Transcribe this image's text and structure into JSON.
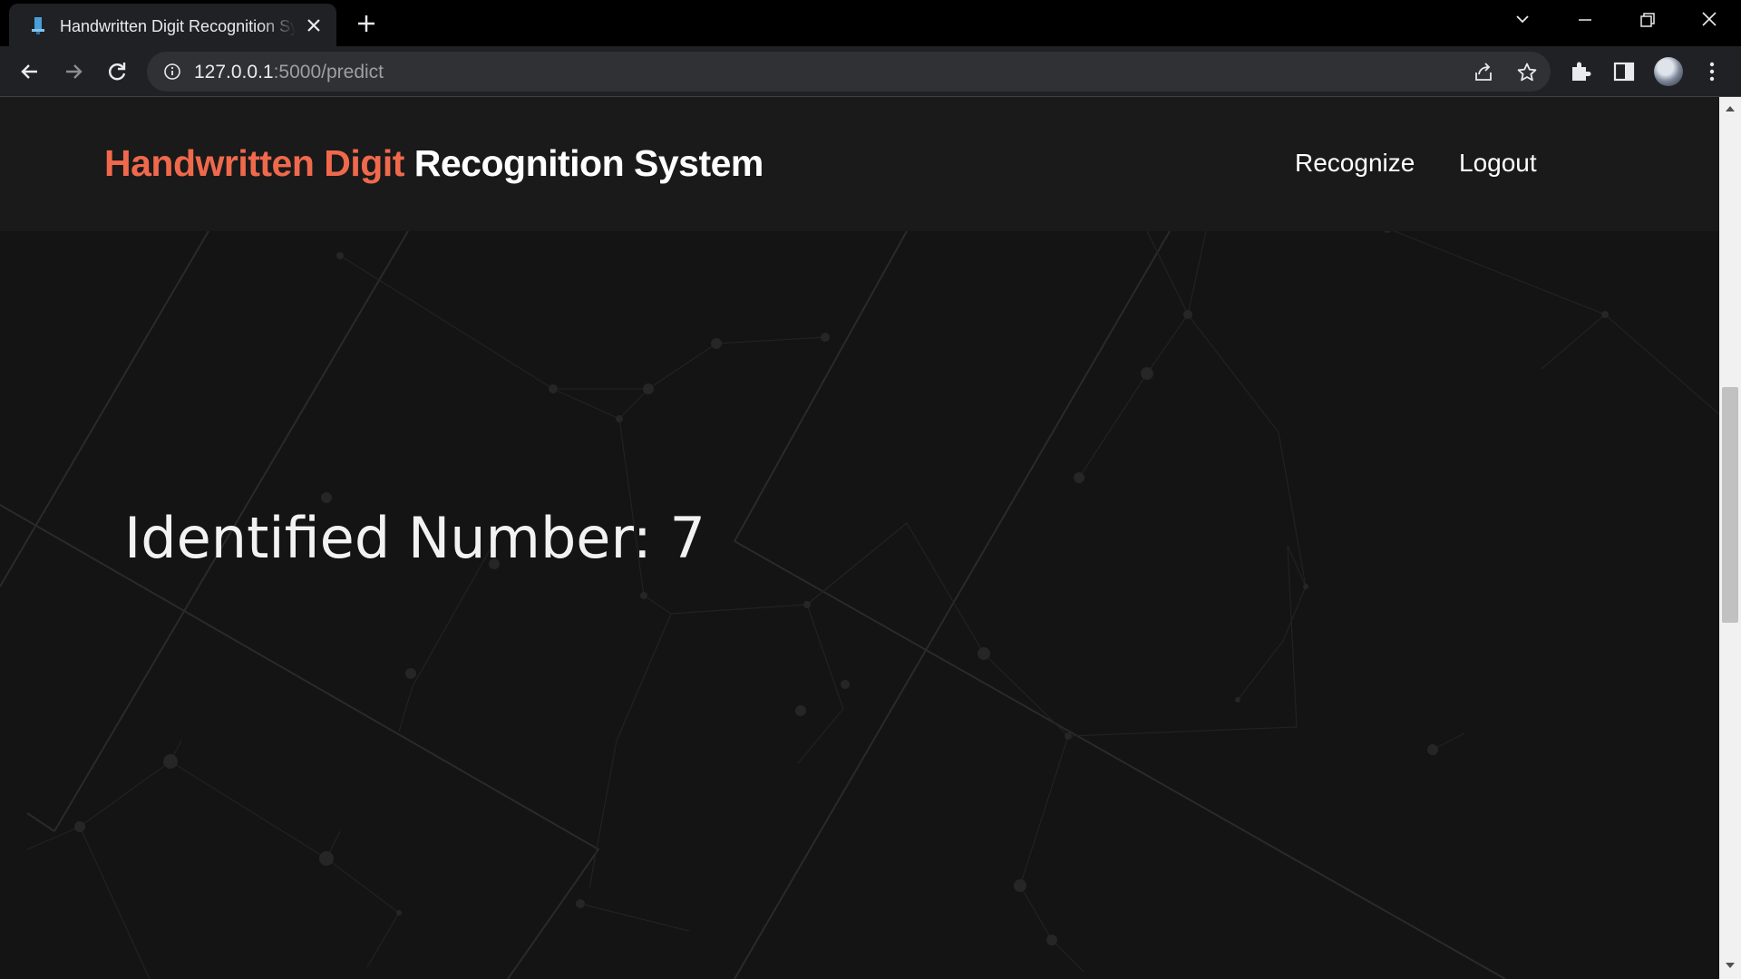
{
  "browser": {
    "tab_title": "Handwritten Digit Recognition System",
    "url_host": "127.0.0.1",
    "url_path": ":5000/predict"
  },
  "site": {
    "brand_accent": "Handwritten Digit",
    "brand_rest": " Recognition System",
    "nav": {
      "recognize": "Recognize",
      "logout": "Logout"
    },
    "result_text": "Identified Number: 7"
  },
  "colors": {
    "accent": "#f0694c",
    "page_bg": "#141414",
    "header_bg": "#1a1a1a"
  }
}
